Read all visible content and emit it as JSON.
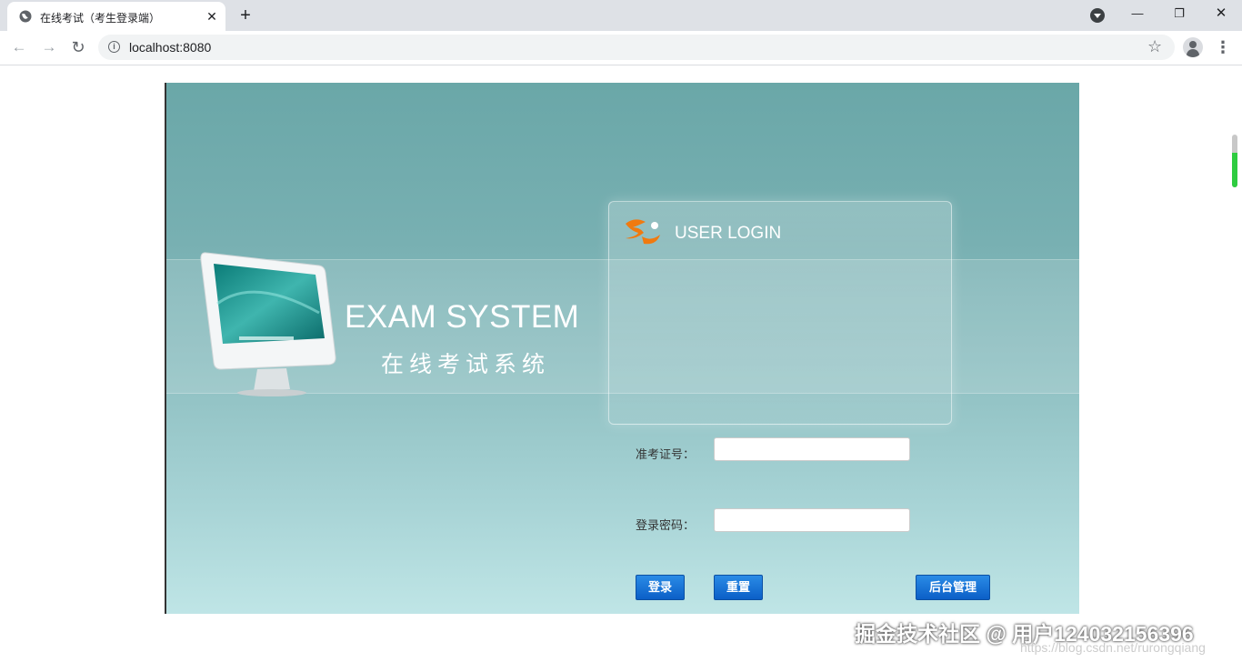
{
  "browser": {
    "tab_title": "在线考试（考生登录端）",
    "tab_close": "✕",
    "new_tab": "+",
    "window_minimize": "—",
    "window_maximize": "❐",
    "window_close": "✕",
    "nav_back": "←",
    "nav_forward": "→",
    "nav_reload": "↻",
    "url": "localhost:8080",
    "bookmark_star": "☆",
    "menu": "⋮"
  },
  "brand": {
    "title_en": "EXAM SYSTEM",
    "title_cn": "在线考试系统"
  },
  "login_panel": {
    "title": "USER LOGIN"
  },
  "form": {
    "exam_id_label": "准考证号：",
    "exam_id_value": "",
    "password_label": "登录密码：",
    "password_value": ""
  },
  "buttons": {
    "login": "登录",
    "reset": "重置",
    "admin": "后台管理"
  },
  "colors": {
    "accent_blue": "#0b5fc7",
    "bg_teal": "#6aa7a8",
    "logo_orange": "#f07a10"
  },
  "watermark": {
    "text": "掘金技术社区 @ 用户124032156396",
    "url": "https://blog.csdn.net/rurongqiang"
  }
}
